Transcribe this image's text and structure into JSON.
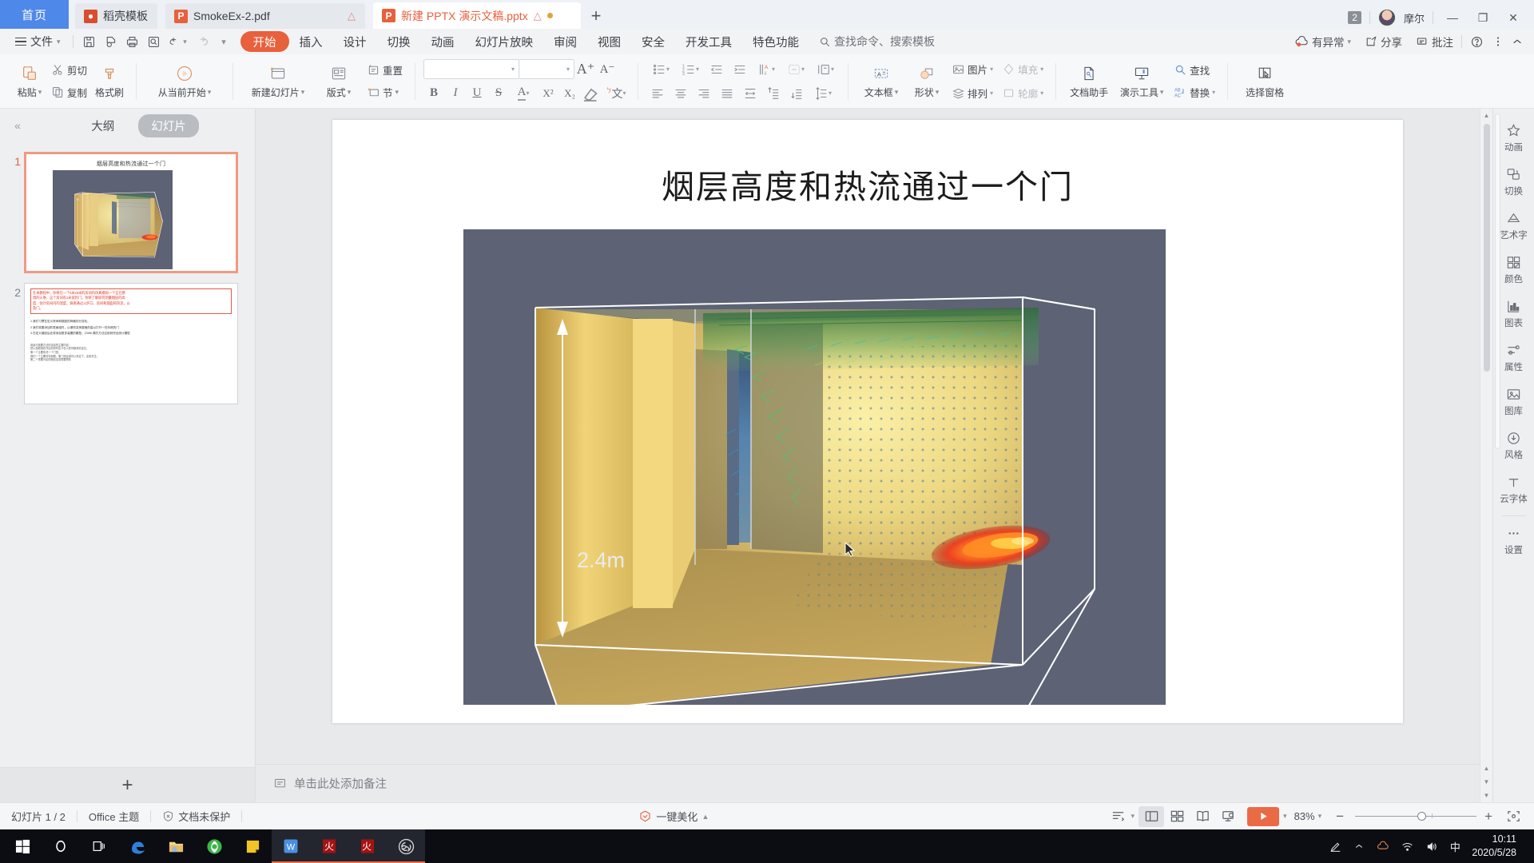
{
  "tabbar": {
    "home_label": "首页",
    "tabs": [
      {
        "label": "稻壳模板",
        "icon": "template-icon",
        "active": false,
        "warn": false,
        "modified": false
      },
      {
        "label": "SmokeEx-2.pdf",
        "icon": "pdf-icon",
        "active": false,
        "warn": true,
        "modified": false
      },
      {
        "label": "新建 PPTX 演示文稿.pptx",
        "icon": "pptx-icon",
        "active": true,
        "warn": true,
        "modified": true
      }
    ],
    "new_tab_label": "+",
    "count_badge": "2",
    "user_name": "摩尔",
    "minimize": "—",
    "restore": "❐",
    "close": "✕"
  },
  "menubar": {
    "file_label": "文件",
    "quick_icons": [
      "save-icon",
      "print-preview-icon",
      "print-icon",
      "find-doc-icon",
      "undo-icon",
      "redo-icon",
      "customize-icon"
    ],
    "items": [
      "开始",
      "插入",
      "设计",
      "切换",
      "动画",
      "幻灯片放映",
      "审阅",
      "视图",
      "安全",
      "开发工具",
      "特色功能"
    ],
    "active_item": "开始",
    "search_placeholder": "查找命令、搜索模板",
    "right_items": [
      {
        "label": "有异常",
        "icon": "cloud-warning-icon"
      },
      {
        "label": "分享",
        "icon": "share-icon"
      },
      {
        "label": "批注",
        "icon": "comment-icon"
      }
    ],
    "help_icon": "help-icon",
    "more_icon": "more-icon",
    "collapse_icon": "chevron-up-icon"
  },
  "ribbon": {
    "clipboard": {
      "paste": "粘贴",
      "cut": "剪切",
      "copy": "复制",
      "format_painter": "格式刷"
    },
    "slideshow": {
      "from_current": "从当前开始"
    },
    "slides": {
      "new_slide": "新建幻灯片",
      "layout": "版式",
      "reset": "重置",
      "section": "节"
    },
    "font": {
      "font_name": "",
      "font_size": "",
      "grow_font": "A⁺",
      "shrink_font": "A⁻",
      "bold": "B",
      "italic": "I",
      "underline": "U",
      "strikethrough": "S",
      "font_color": "A",
      "superscript": "X²",
      "subscript": "X₂",
      "clear_format": "clear-format-icon",
      "pinyin": "文"
    },
    "paragraph": {
      "bullets": "bullets-icon",
      "numbering": "numbering-icon",
      "decrease_indent": "decrease-indent-icon",
      "increase_indent": "increase-indent-icon",
      "text_direction": "text-direction-icon",
      "align_box": "align-box-icon",
      "columns": "columns-icon",
      "align_left": "align-left-icon",
      "align_center": "align-center-icon",
      "align_right": "align-right-icon",
      "justify": "justify-icon",
      "distribute": "distribute-icon",
      "line_spacing": "line-spacing-icon"
    },
    "drawing": {
      "textbox": "文本框",
      "shape": "形状",
      "picture": "图片",
      "arrange": "排列",
      "fill": "填充",
      "outline": "轮廓"
    },
    "tools": {
      "doc_assistant": "文档助手",
      "present_tools": "演示工具",
      "find": "查找",
      "replace": "替换",
      "selection_pane": "选择窗格"
    }
  },
  "leftpanel": {
    "collapse_icon": "double-chevron-left-icon",
    "tab_outline": "大纲",
    "tab_slides": "幻灯片",
    "active_tab": "幻灯片",
    "slides": [
      {
        "number": "1",
        "selected": true,
        "title": "烟层高度和热流通过一个门"
      },
      {
        "number": "2",
        "selected": false,
        "red_text": [
          "在本教程中，你将在一个5米x5米的房间内仿真模拟一个正在燃",
          "烧的火堆，这个房间有1米宽的门。你将了解如何测量烟层的高",
          "度、估计房间内的温度，调查通过火炉口、房间和烟囱的热流，以",
          "及门。"
        ],
        "bullets": [
          "1 我们习惯在定义房间和烟囱的网格划分变化。",
          "2 我们将要添加的表面组件，以便改变房屋墙的高以打开一些未燃的门",
          "3 在定义烟囱后还将添加更多装置的模型。CWiki 模式方法应用到完全统计模型"
        ],
        "small_text": [
          "用途与需要方法的活动的主要内容：",
          "把火焰燃烧在外灶的同时定义在火的列管系的定位，",
          "第一个主要情况一个门型，",
          "我们一个主要情况和图，第三段区域可以安定了、定用先生，",
          "第二个重要分区的路径定量需要预防"
        ]
      }
    ],
    "add_slide_label": "+"
  },
  "slide": {
    "title": "烟层高度和热流通过一个门",
    "dimension_label": "2.4m"
  },
  "notes": {
    "icon": "notes-icon",
    "placeholder": "单击此处添加备注"
  },
  "rightrail": {
    "items": [
      {
        "label": "动画",
        "icon": "animation-star-icon"
      },
      {
        "label": "切换",
        "icon": "transition-icon"
      },
      {
        "label": "艺术字",
        "icon": "wordart-icon"
      },
      {
        "label": "颜色",
        "icon": "color-palette-icon"
      },
      {
        "label": "图表",
        "icon": "chart-icon"
      },
      {
        "label": "属性",
        "icon": "properties-icon"
      },
      {
        "label": "图库",
        "icon": "gallery-icon"
      },
      {
        "label": "风格",
        "icon": "style-icon"
      },
      {
        "label": "云字体",
        "icon": "cloud-font-icon"
      },
      {
        "label": "设置",
        "icon": "settings-dots-icon"
      }
    ]
  },
  "statusbar": {
    "slide_count": "幻灯片 1 / 2",
    "theme": "Office 主题",
    "protection": "文档未保护",
    "protection_icon": "shield-icon",
    "beautify": "一键美化",
    "beautify_icon": "beautify-icon",
    "view_buttons": [
      {
        "name": "outline-view",
        "active": false
      },
      {
        "name": "normal-view",
        "active": true
      },
      {
        "name": "slide-sorter-view",
        "active": false
      },
      {
        "name": "reading-view",
        "active": false
      },
      {
        "name": "presenter-view",
        "active": false
      }
    ],
    "play_icon": "play-icon",
    "zoom_level": "83%",
    "zoom_out": "−",
    "zoom_in": "+",
    "fit_icon": "fit-to-window-icon"
  },
  "taskbar": {
    "icons": [
      "windows-start-icon",
      "cortana-search-icon",
      "task-view-icon",
      "edge-icon",
      "file-explorer-icon",
      "browser-icon",
      "notes-icon",
      "wps-icon",
      "fire-app-icon",
      "fire-app-2-icon",
      "obs-icon"
    ],
    "tray": [
      "pen-icon",
      "chevron-up-icon",
      "cloud-icon",
      "network-icon",
      "volume-icon",
      "ime-icon",
      "lang-icon"
    ],
    "ime_label": "中",
    "time": "10:11",
    "date": "2020/5/28"
  },
  "colors": {
    "accent": "#e8603c",
    "home_tab_blue": "#4e88e8",
    "slide_bg": "#5d6275",
    "taskbar": "#0b0d12"
  }
}
